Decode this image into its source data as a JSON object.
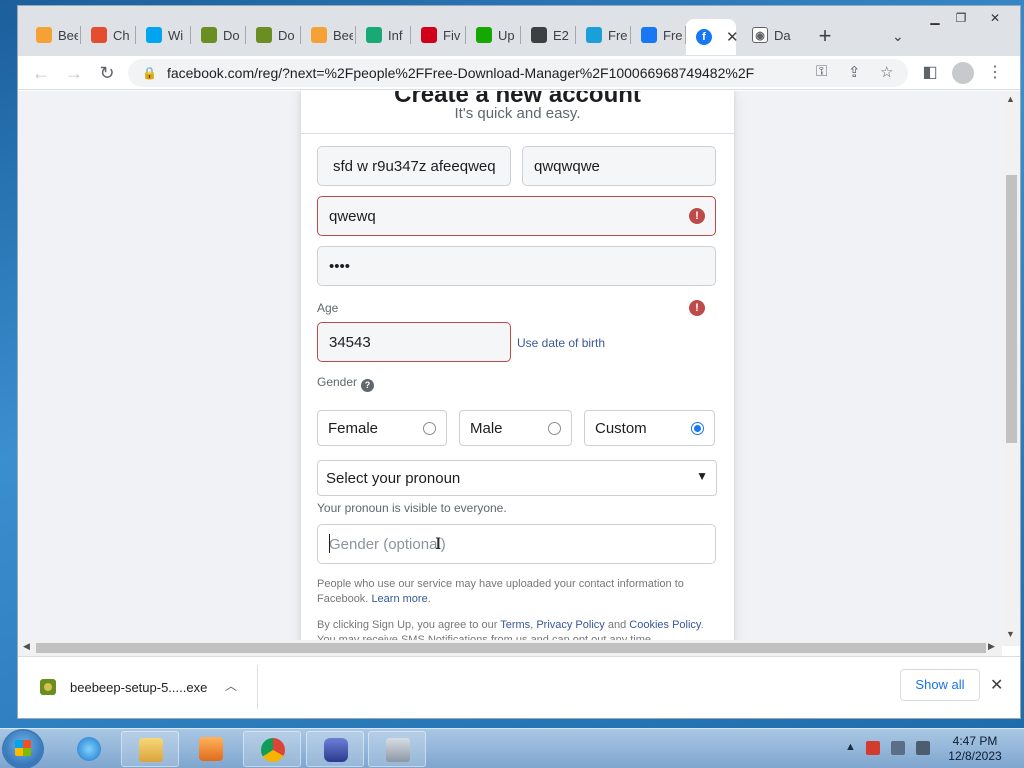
{
  "browser": {
    "tabs": [
      {
        "label": "Bee",
        "color": "#f4a236"
      },
      {
        "label": "Ch",
        "color": "#e44d2e"
      },
      {
        "label": "Wi",
        "color": "#00a4ef"
      },
      {
        "label": "Do",
        "color": "#6b8e23"
      },
      {
        "label": "Do",
        "color": "#6b8e23"
      },
      {
        "label": "Bee",
        "color": "#f4a236"
      },
      {
        "label": "Inf",
        "color": "#19a974"
      },
      {
        "label": "Fiv",
        "color": "#d0021b"
      },
      {
        "label": "Up",
        "color": "#14a800"
      },
      {
        "label": "E2",
        "color": "#3c4043"
      },
      {
        "label": "Fre",
        "color": "#1a9fd8"
      },
      {
        "label": "Fre",
        "color": "#1877f2"
      }
    ],
    "active_tab": {
      "label": "",
      "color": "#1877f2"
    },
    "last_tab": {
      "label": "Da",
      "color": "#5f6368"
    },
    "url": "facebook.com/reg/?next=%2Fpeople%2FFree-Download-Manager%2F100066968749482%2F"
  },
  "signup": {
    "title": "Create a new account",
    "subtitle": "It's quick and easy.",
    "first_name": "sfd  w r9u347z afeeqweq",
    "last_name": "qwqwqwe",
    "mobile_or_email": "qwewq",
    "password": "••••",
    "age_label": "Age",
    "age_value": "34543",
    "use_dob_link": "Use date of birth",
    "gender_label": "Gender",
    "gender_options": [
      {
        "label": "Female",
        "selected": false
      },
      {
        "label": "Male",
        "selected": false
      },
      {
        "label": "Custom",
        "selected": true
      }
    ],
    "pronoun_select": "Select your pronoun",
    "pronoun_note": "Your pronoun is visible to everyone.",
    "gender_optional_placeholder": "Gender (optional)",
    "contact_info_text": "People who use our service may have uploaded your contact information to Facebook.",
    "learn_more": "Learn more",
    "terms_prefix": "By clicking Sign Up, you agree to our",
    "terms": "Terms",
    "privacy_policy": "Privacy Policy",
    "and": "and",
    "cookies_policy": "Cookies Policy",
    "sms_text": "You may receive SMS Notifications from us and can opt out any time."
  },
  "downloads": {
    "filename": "beebeep-setup-5.....exe",
    "show_all": "Show all"
  },
  "taskbar": {
    "time": "4:47 PM",
    "date": "12/8/2023"
  }
}
